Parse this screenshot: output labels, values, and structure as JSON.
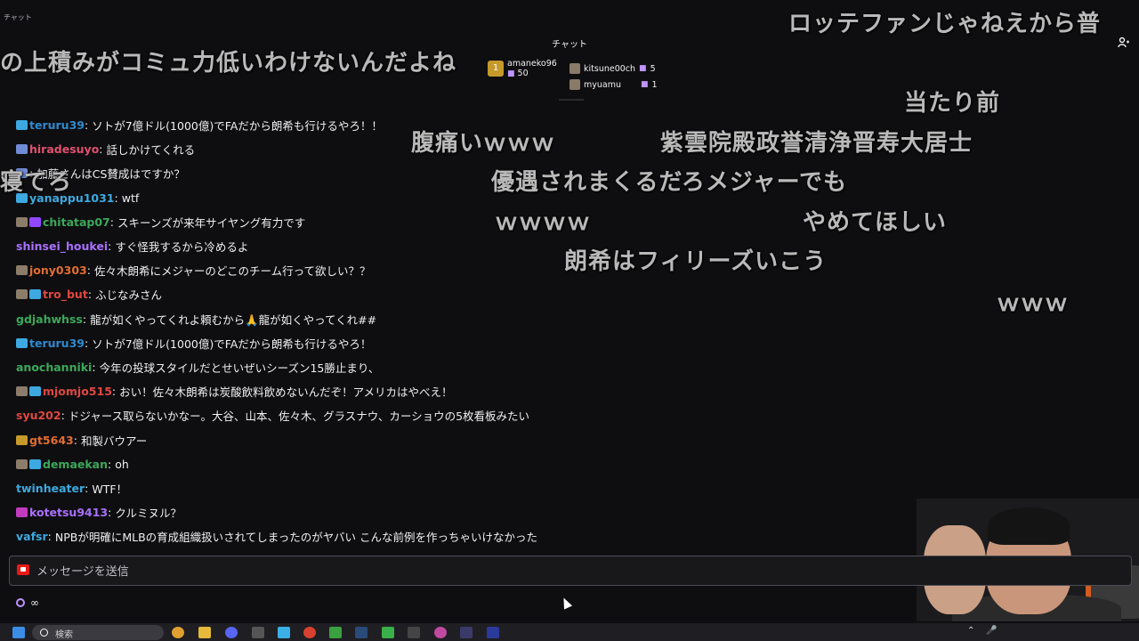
{
  "top_tag": "チャット",
  "chat_title": "チャット",
  "hype_chat": [
    {
      "name": "amaneko96",
      "count": "50"
    },
    {
      "name": "kitsune00ch",
      "count": "5"
    },
    {
      "name": "myuamu",
      "count": "1"
    }
  ],
  "messages": [
    {
      "user": "teruru39",
      "color": "#2e8bd1",
      "badges": [
        "sub"
      ],
      "text": "ソトが7億ドル(1000億)でFAだから朗希も行けるやろ！！"
    },
    {
      "user": "hiradesuyo",
      "color": "#e05070",
      "badges": [
        "prime"
      ],
      "text": "話しかけてくれる"
    },
    {
      "user": "",
      "color": "#e05070",
      "badges": [
        "prime"
      ],
      "text": "加藤さんはCS賛成はですか？"
    },
    {
      "user": "yanappu1031",
      "color": "#3da9e0",
      "badges": [
        "sub"
      ],
      "text": "wtf"
    },
    {
      "user": "chitatap07",
      "color": "#3ca85a",
      "badges": [
        "ava",
        "vip"
      ],
      "text": "スキーンズが来年サイヤング有力です"
    },
    {
      "user": "shinsei_houkei",
      "color": "#a970ff",
      "badges": [],
      "text": "すぐ怪我するから冷めるよ"
    },
    {
      "user": "jony0303",
      "color": "#e26d32",
      "badges": [
        "ava"
      ],
      "text": "佐々木朗希にメジャーのどこのチーム行って欲しい？？"
    },
    {
      "user": "tro_but",
      "color": "#e0473f",
      "badges": [
        "ava",
        "sub"
      ],
      "text": "ふじなみさん"
    },
    {
      "user": "gdjahwhss",
      "color": "#3ca85a",
      "badges": [],
      "text": "龍が如くやってくれよ頼むから🙏龍が如くやってくれ##"
    },
    {
      "user": "teruru39",
      "color": "#2e8bd1",
      "badges": [
        "sub"
      ],
      "text": "ソトが7億ドル(1000億)でFAだから朗希も行けるやろ！"
    },
    {
      "user": "anochanniki",
      "color": "#3ca85a",
      "badges": [],
      "text": "今年の投球スタイルだとせいぜいシーズン15勝止まり、"
    },
    {
      "user": "mjomjo515",
      "color": "#e0473f",
      "badges": [
        "ava",
        "sub"
      ],
      "text": "おい！佐々木朗希は炭酸飲料飲めないんだぞ！アメリカはやべえ！"
    },
    {
      "user": "syu202",
      "color": "#e0473f",
      "badges": [],
      "text": "ドジャース取らないかなー。大谷、山本、佐々木、グラスナウ、カーショウの5枚看板みたい"
    },
    {
      "user": "gt5643",
      "color": "#e26d32",
      "badges": [
        "gold"
      ],
      "text": "和製バウアー"
    },
    {
      "user": "demaekan",
      "color": "#3ca85a",
      "badges": [
        "ava",
        "sub"
      ],
      "text": "oh"
    },
    {
      "user": "twinheater",
      "color": "#3da9e0",
      "badges": [],
      "text": "WTF！"
    },
    {
      "user": "kotetsu9413",
      "color": "#a970ff",
      "badges": [
        "pink"
      ],
      "text": "クルミヌル？"
    },
    {
      "user": "vafsr",
      "color": "#3da9e0",
      "badges": [],
      "text": "NPBが明確にMLBの育成組織扱いされてしまったのがヤバい こんな前例を作っちゃいけなかった"
    }
  ],
  "danmaku": [
    "ロッテファンじゃねえから普",
    "の上積みがコミュ力低いわけないんだよね",
    "当たり前",
    "腹痛いｗｗｗ",
    "紫雲院殿政誉清浄晋寿大居士",
    "寝てろ",
    "優遇されまくるだろメジャーでも",
    "ｗｗｗｗ",
    "やめてほしい",
    "朗希はフィリーズいこう",
    "ｗｗｗ"
  ],
  "input": {
    "placeholder": "メッセージを送信"
  },
  "points": {
    "value": "∞"
  },
  "taskbar": {
    "search_label": "検索"
  },
  "colors": {
    "background": "#0e0e10",
    "accent": "#9147ff",
    "input_border": "#4c4c55"
  }
}
